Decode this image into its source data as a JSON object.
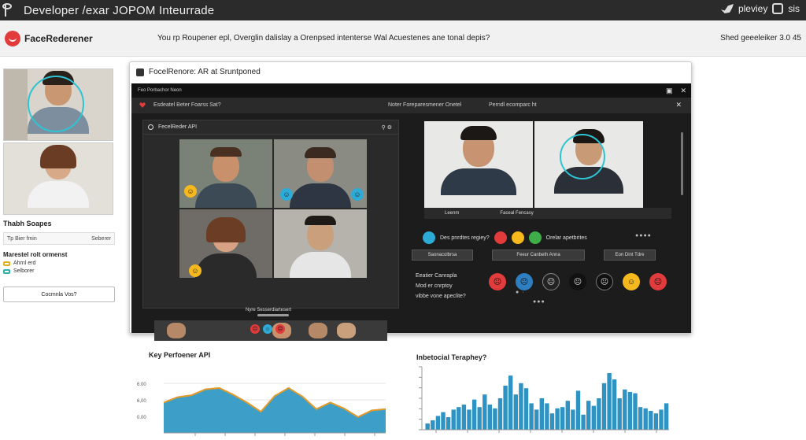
{
  "topbar": {
    "title": "Developer /exar JOPOM  Inteurrade",
    "right_label": "pleviey",
    "right_label2": "sis"
  },
  "header": {
    "brand": "FaceRederener",
    "question": "You rp Roupener epl, Overglin dalislay a Orenpsed intenterse Wal Acuestenes ane tonal depis?",
    "version": "Shed geeeleiker 3.0 45"
  },
  "left": {
    "section_title": "Thabh Soapes",
    "field_label": "Tp Bier fmin",
    "field_value": "Seberer",
    "sub_title": "Marestel rolt ormenst",
    "opt1": "Ahrnl erd",
    "opt2": "Selborer",
    "button": "Cocmnla Vos?"
  },
  "window": {
    "title": "FocelRenore: AR at Sruntponed",
    "inner_title": "Feo Porbachor Neon",
    "bar_a": "Esdeatel Beter Foarss Sat?",
    "bar_b": "Noter   Foreparesmener Onetel",
    "bar_c": "Perndl ecomparc ht",
    "panel_title": "FecelReder API",
    "panel_caption": "Nyre Sesserdiartesert",
    "rp_caption_a": "Leenm",
    "rp_caption_b": "Faceal Fencasy",
    "row1_text": "Des pnrdtes regiey?",
    "row1_text2": "Orelar apetbrites",
    "sel1": "Saonacolbrsa",
    "sel2": "Feeur Canbeth Anna",
    "sel3": "Eon Dint Tdre",
    "q1": "Eeatier Canrapla",
    "q2": "Mod er cnrptoy",
    "q3": "vibbe vone apeclite?"
  },
  "chart_left": {
    "title": "Key Perfoener API",
    "ytick_labels": [
      "6.00",
      "6,00",
      "0.00"
    ]
  },
  "chart_right": {
    "title": "Inbetocial Teraphey?"
  },
  "chart_data": [
    {
      "type": "area",
      "title": "Key Perfoener API",
      "ylim": [
        0,
        10
      ],
      "values": [
        4.6,
        5.4,
        5.7,
        6.6,
        6.8,
        5.8,
        4.6,
        3.2,
        5.6,
        6.8,
        5.5,
        3.6,
        4.6,
        3.7,
        2.4,
        3.4,
        3.6
      ]
    },
    {
      "type": "bar",
      "title": "Inbetocial Teraphey?",
      "ylim": [
        0,
        10
      ],
      "values": [
        1,
        1.5,
        2.2,
        2.8,
        2,
        3.2,
        3.6,
        4,
        3.2,
        4.8,
        3.6,
        5.6,
        4,
        3.4,
        5,
        7,
        8.6,
        5.6,
        7.4,
        6.6,
        4.2,
        3.2,
        5,
        4.2,
        2.6,
        3.4,
        3.6,
        4.6,
        3.2,
        6.2,
        2.4,
        4.6,
        3.8,
        5,
        7.4,
        9,
        8,
        5,
        6.4,
        6,
        5.8,
        3.6,
        3.4,
        3,
        2.6,
        3.2,
        4.2
      ]
    }
  ]
}
